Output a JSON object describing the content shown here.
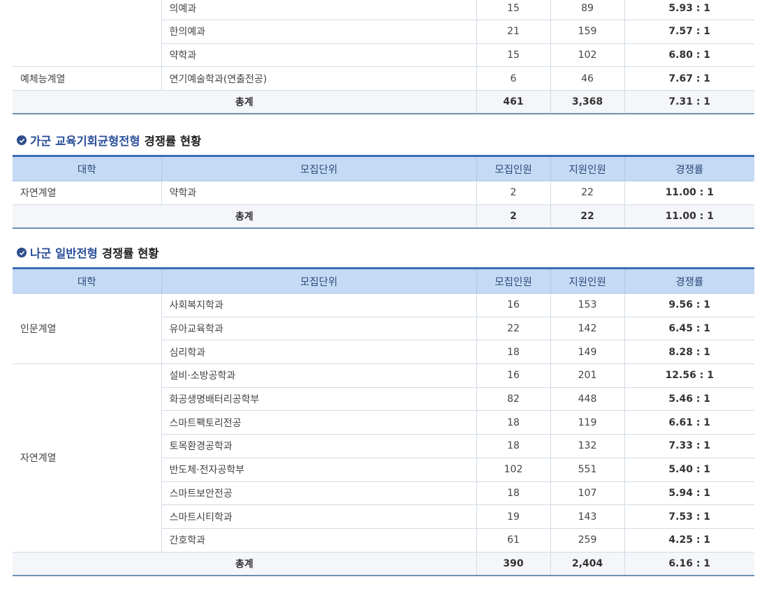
{
  "table1": {
    "rows": [
      {
        "univ": "",
        "unit": "의예과",
        "recruit": "15",
        "apply": "89",
        "rate": "5.93 : 1"
      },
      {
        "univ": "",
        "unit": "한의예과",
        "recruit": "21",
        "apply": "159",
        "rate": "7.57 : 1"
      },
      {
        "univ": "",
        "unit": "약학과",
        "recruit": "15",
        "apply": "102",
        "rate": "6.80 : 1"
      },
      {
        "univ": "예체능계열",
        "unit": "연기예술학과(연출전공)",
        "recruit": "6",
        "apply": "46",
        "rate": "7.67 : 1"
      }
    ],
    "total": {
      "label": "총계",
      "recruit": "461",
      "apply": "3,368",
      "rate": "7.31 : 1"
    }
  },
  "section2": {
    "title_highlight": "가군 교육기회균형전형",
    "title_rest": "경쟁률 현황",
    "headers": {
      "univ": "대학",
      "unit": "모집단위",
      "recruit": "모집인원",
      "apply": "지원인원",
      "rate": "경쟁률"
    },
    "rows": [
      {
        "univ": "자연계열",
        "unit": "약학과",
        "recruit": "2",
        "apply": "22",
        "rate": "11.00 : 1"
      }
    ],
    "total": {
      "label": "총계",
      "recruit": "2",
      "apply": "22",
      "rate": "11.00 : 1"
    }
  },
  "section3": {
    "title_highlight": "나군 일반전형",
    "title_rest": "경쟁률 현황",
    "headers": {
      "univ": "대학",
      "unit": "모집단위",
      "recruit": "모집인원",
      "apply": "지원인원",
      "rate": "경쟁률"
    },
    "groups": [
      {
        "univ": "인문계열",
        "rows": [
          {
            "unit": "사회복지학과",
            "recruit": "16",
            "apply": "153",
            "rate": "9.56 : 1"
          },
          {
            "unit": "유아교육학과",
            "recruit": "22",
            "apply": "142",
            "rate": "6.45 : 1"
          },
          {
            "unit": "심리학과",
            "recruit": "18",
            "apply": "149",
            "rate": "8.28 : 1"
          }
        ]
      },
      {
        "univ": "자연계열",
        "rows": [
          {
            "unit": "설비·소방공학과",
            "recruit": "16",
            "apply": "201",
            "rate": "12.56 : 1"
          },
          {
            "unit": "화공생명배터리공학부",
            "recruit": "82",
            "apply": "448",
            "rate": "5.46 : 1"
          },
          {
            "unit": "스마트팩토리전공",
            "recruit": "18",
            "apply": "119",
            "rate": "6.61 : 1"
          },
          {
            "unit": "토목환경공학과",
            "recruit": "18",
            "apply": "132",
            "rate": "7.33 : 1"
          },
          {
            "unit": "반도체·전자공학부",
            "recruit": "102",
            "apply": "551",
            "rate": "5.40 : 1"
          },
          {
            "unit": "스마트보안전공",
            "recruit": "18",
            "apply": "107",
            "rate": "5.94 : 1"
          },
          {
            "unit": "스마트시티학과",
            "recruit": "19",
            "apply": "143",
            "rate": "7.53 : 1"
          },
          {
            "unit": "간호학과",
            "recruit": "61",
            "apply": "259",
            "rate": "4.25 : 1"
          }
        ]
      }
    ],
    "total": {
      "label": "총계",
      "recruit": "390",
      "apply": "2,404",
      "rate": "6.16 : 1"
    }
  },
  "colors": {
    "accent": "#3a6db3",
    "header_bg": "#c5daf5",
    "title_highlight": "#2b4f9a",
    "total_bg": "#f4f6f9"
  }
}
